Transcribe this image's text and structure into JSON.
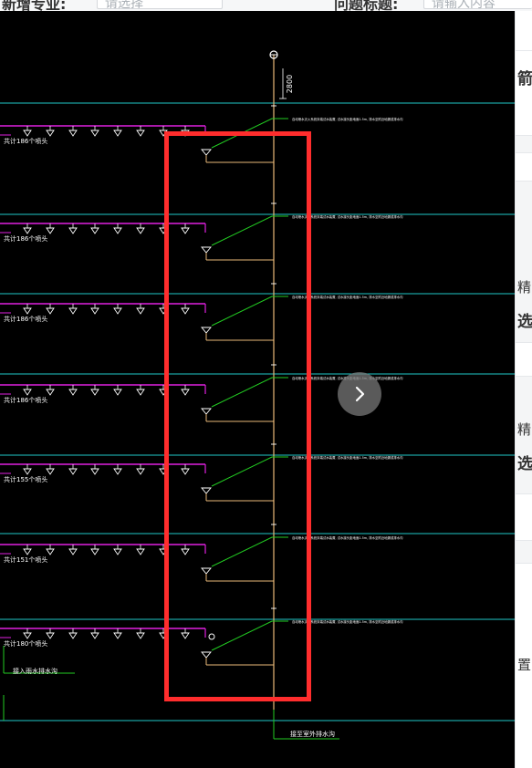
{
  "topbar": {
    "major_label": "新增专业:",
    "major_placeholder": "请选择",
    "question_label": "问题标题:",
    "question_placeholder": "请输入内容"
  },
  "drawing": {
    "elevation_dim": "2800",
    "floors": [
      {
        "pipe_label": "共计186个喷头",
        "note": "自动喷水灭火系统末端试水装置, 试水接头距地面1.5m, 排水至附近地漏或排水沟"
      },
      {
        "pipe_label": "共计186个喷头",
        "note": "自动喷水灭火系统末端试水装置, 试水接头距地面1.5m, 排水至附近地漏或排水沟"
      },
      {
        "pipe_label": "共计186个喷头",
        "note": "自动喷水灭火系统末端试水装置, 试水接头距地面1.5m, 排水至附近地漏或排水沟"
      },
      {
        "pipe_label": "共计186个喷头",
        "note": "自动喷水灭火系统末端试水装置, 试水接头距地面1.5m, 排水至附近地漏或排水沟"
      },
      {
        "pipe_label": "共计155个喷头",
        "note": "自动喷水灭火系统末端试水装置, 试水接头距地面1.5m, 排水至附近地漏或排水沟"
      },
      {
        "pipe_label": "共计151个喷头",
        "note": "自动喷水灭火系统末端试水装置, 试水接头距地面1.5m, 排水至附近地漏或排水沟"
      },
      {
        "pipe_label": "共计180个喷头",
        "note": "自动喷水灭火系统末端试水装置, 试水接头距地面1.5m, 排水至附近地漏或排水沟"
      }
    ],
    "bottom_left_label": "接入雨水排水沟",
    "bottom_right_label": "接至室外排水沟"
  },
  "right_panel": {
    "frag_title": "箭",
    "frag_1": "精",
    "frag_2": "选",
    "frag_3": "精",
    "frag_4": "选",
    "frag_5": "置"
  },
  "colors": {
    "cad_bg": "#000000",
    "floor_line": "#1fc8c8",
    "branch_pipe": "#e020e0",
    "riser": "#e8b878",
    "note_leader": "#22cc22",
    "highlight": "#ff2d2d"
  },
  "icons": {
    "next": "chevron-right-icon",
    "valve": "valve-icon",
    "sprinkler": "sprinkler-icon"
  }
}
